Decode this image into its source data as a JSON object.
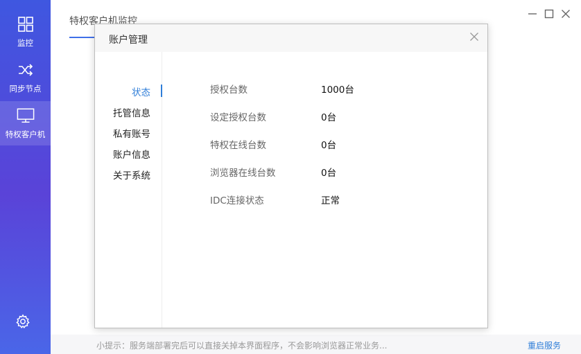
{
  "sidebar": {
    "items": [
      {
        "label": "监控",
        "icon": "grid-icon"
      },
      {
        "label": "同步节点",
        "icon": "shuffle-icon"
      },
      {
        "label": "特权客户机",
        "icon": "monitor-icon"
      }
    ],
    "active_index": 2,
    "settings_icon": "gear-icon"
  },
  "background": {
    "title": "特权客户机监控"
  },
  "modal": {
    "title": "账户管理",
    "menu": [
      {
        "label": "状态",
        "active": true
      },
      {
        "label": "托管信息"
      },
      {
        "label": "私有账号"
      },
      {
        "label": "账户信息"
      },
      {
        "label": "关于系统"
      }
    ],
    "rows": [
      {
        "label": "授权台数",
        "value": "1000台"
      },
      {
        "label": "设定授权台数",
        "value": "0台"
      },
      {
        "label": "特权在线台数",
        "value": "0台"
      },
      {
        "label": "浏览器在线台数",
        "value": "0台"
      },
      {
        "label": "IDC连接状态",
        "value": "正常"
      }
    ]
  },
  "footer": {
    "tip": "小提示：服务端部署完后可以直接关掉本界面程序，不会影响浏览器正常业务...",
    "restart_label": "重启服务"
  },
  "colors": {
    "accent": "#2f7ed8",
    "sidebar_top": "#3f57e0",
    "sidebar_mid": "#5a43d8"
  }
}
